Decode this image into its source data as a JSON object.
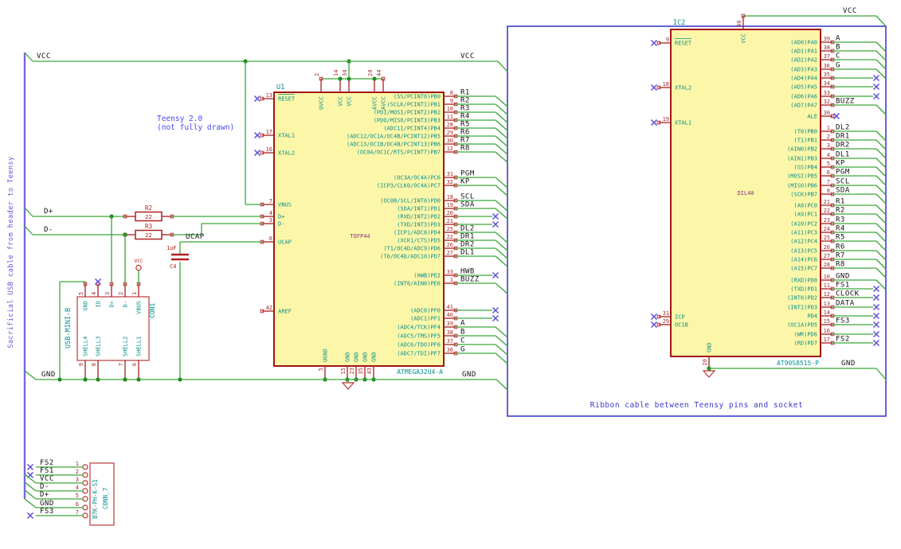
{
  "notes": {
    "left_rotated": "Sacrificial USB cable from header to Teensy",
    "teensy1": "Teensy 2.0",
    "teensy2": "(not fully drawn)",
    "ribbon": "Ribbon cable between Teensy pins and socket"
  },
  "colors": {
    "wire": "#3aa63a",
    "bus": "#7668d8",
    "frame": "#3c3ccd",
    "ic_border": "#a31515",
    "ic_fill": "#fcf7a8",
    "conn_border": "#c86060",
    "pin_name": "#0a8f8f",
    "pin_number": "#a62a2a",
    "net_label": "#101010",
    "junction": "#228b22",
    "nc": "#5b4fdd",
    "device_red": "#b02020",
    "package": "#8d2f8d"
  },
  "nets": {
    "vcc": "VCC",
    "gnd": "GND",
    "dplus": "D+",
    "dminus": "D-",
    "ucap": "UCAP"
  },
  "u1": {
    "ref": "U1",
    "value": "ATMEGA32U4-A",
    "package": "TQFP44",
    "top_pins": [
      [
        "2",
        "UVCC"
      ],
      [
        "14",
        "VCC"
      ],
      [
        "34",
        "VCC"
      ],
      [
        "24",
        "AVCC"
      ],
      [
        "44",
        "AVCC"
      ]
    ],
    "bottom_pins": [
      [
        "5",
        "UGND"
      ],
      [
        "15",
        "GND"
      ],
      [
        "23",
        "GND"
      ],
      [
        "35",
        "GND"
      ],
      [
        "43",
        "GND"
      ]
    ],
    "left_pins": [
      [
        "13",
        "RESET",
        "nc"
      ],
      [
        "17",
        "XTAL1",
        "nc"
      ],
      [
        "16",
        "XTAL2",
        "nc"
      ],
      [
        "7",
        "VBUS",
        "wire"
      ],
      [
        "4",
        "D+",
        "wire"
      ],
      [
        "3",
        "D-",
        "wire"
      ],
      [
        "6",
        "UCAP",
        "wire"
      ],
      [
        "42",
        "AREF",
        "stub"
      ]
    ],
    "right_pins": [
      [
        "8",
        "(SS/PCINT0)PB0",
        "R1",
        "bus"
      ],
      [
        "9",
        "(SCLK/PCINT1)PB1",
        "R2",
        "bus"
      ],
      [
        "10",
        "(PDI/MOSI/PCINT2)PB2",
        "R3",
        "bus"
      ],
      [
        "11",
        "(PDO/MISO/PCINT3)PB3",
        "R4",
        "bus"
      ],
      [
        "28",
        "(ADC11/PCINT4)PB4",
        "R5",
        "bus"
      ],
      [
        "29",
        "(ADC12/OC1A/OC4B/PCINT12)PB5",
        "R6",
        "bus"
      ],
      [
        "30",
        "(ADC13/OC1B/OC4B/PCINT13)PB6",
        "R7",
        "bus"
      ],
      [
        "12",
        "(OC0A/OC1C/RTS/PCINT7)PB7",
        "R8",
        "bus"
      ],
      [
        "31",
        "(OC3A/OC4A)PC6",
        "PGM",
        "bus"
      ],
      [
        "32",
        "(ICP3/CLK0/OC4A)PC7",
        "KP",
        "bus"
      ],
      [
        "18",
        "(OC0B/SCL/INT0)PD0",
        "SCL",
        "bus"
      ],
      [
        "19",
        "(SDA/INT1)PD1",
        "SDA",
        "bus"
      ],
      [
        "20",
        "(RXD/INT2)PD2",
        "",
        "nc"
      ],
      [
        "21",
        "(TXD/INT3)PD3",
        "",
        "nc"
      ],
      [
        "25",
        "(ICP1/ADC8)PD4",
        "DL2",
        "bus"
      ],
      [
        "22",
        "(XCK1/CTS)PD5",
        "DR1",
        "bus"
      ],
      [
        "26",
        "(T1/OC4D/ADC9)PD6",
        "DR2",
        "bus"
      ],
      [
        "27",
        "(T0/OC4D/ADC10)PD7",
        "DL1",
        "bus"
      ],
      [
        "33",
        "(HWB)PE2",
        "HWB",
        "nc"
      ],
      [
        "1",
        "(INT6/AIN0)PE6",
        "BUZZ",
        "bus"
      ],
      [
        "41",
        "(ADC0)PF0",
        "",
        "nc"
      ],
      [
        "40",
        "(ADC1)PF1",
        "",
        "nc"
      ],
      [
        "39",
        "(ADC4/TCK)PF4",
        "A",
        "bus"
      ],
      [
        "38",
        "(ADC5/TMS)PF5",
        "B",
        "bus"
      ],
      [
        "37",
        "(ADC6/TDO)PF6",
        "C",
        "bus"
      ],
      [
        "36",
        "(ADC7/TDI)PF7",
        "G",
        "bus"
      ]
    ]
  },
  "ic2": {
    "ref": "IC2",
    "value": "AT90S8515-P",
    "package": "DIL40",
    "top_pins": [
      [
        "40",
        "VCC"
      ]
    ],
    "bottom_pins": [
      [
        "20",
        "GND"
      ]
    ],
    "left_pins": [
      [
        "9",
        "RESET",
        "nc"
      ],
      [
        "18",
        "XTAL2",
        "nc"
      ],
      [
        "19",
        "XTAL1",
        "nc"
      ],
      [
        "31",
        "ICP",
        "nc"
      ],
      [
        "29",
        "OC1B",
        "nc"
      ]
    ],
    "right_pins": [
      [
        "39",
        "(AD0)PA0",
        "A",
        "bus"
      ],
      [
        "38",
        "(AD1)PA1",
        "B",
        "bus"
      ],
      [
        "37",
        "(AD2)PA2",
        "C",
        "bus"
      ],
      [
        "36",
        "(AD3)PA3",
        "G",
        "bus"
      ],
      [
        "35",
        "(AD4)PA4",
        "",
        "nc"
      ],
      [
        "34",
        "(AD5)PA5",
        "",
        "nc"
      ],
      [
        "33",
        "(AD6)PA6",
        "",
        "nc"
      ],
      [
        "32",
        "(AD7)PA7",
        "BUZZ",
        "bus"
      ],
      [
        "30",
        "ALE",
        "",
        "ncshort"
      ],
      [
        "1",
        "(T0)PB0",
        "DL2",
        "bus"
      ],
      [
        "2",
        "(T1)PB1",
        "DR1",
        "bus"
      ],
      [
        "3",
        "(AIN0)PB2",
        "DR2",
        "bus"
      ],
      [
        "4",
        "(AIN1)PB3",
        "DL1",
        "bus"
      ],
      [
        "5",
        "(SS)PB4",
        "KP",
        "bus"
      ],
      [
        "6",
        "(MOSI)PB5",
        "PGM",
        "bus"
      ],
      [
        "7",
        "(MISO)PB6",
        "SCL",
        "bus"
      ],
      [
        "8",
        "(SCK)PB7",
        "SDA",
        "bus"
      ],
      [
        "21",
        "(A8)PC0",
        "R1",
        "bus"
      ],
      [
        "22",
        "(A9)PC1",
        "R2",
        "bus"
      ],
      [
        "23",
        "(A10)PC2",
        "R3",
        "bus"
      ],
      [
        "24",
        "(A11)PC3",
        "R4",
        "bus"
      ],
      [
        "25",
        "(A12)PC4",
        "R5",
        "bus"
      ],
      [
        "26",
        "(A13)PC5",
        "R6",
        "bus"
      ],
      [
        "27",
        "(A14)PC6",
        "R7",
        "bus"
      ],
      [
        "28",
        "(A15)PC7",
        "R8",
        "bus"
      ],
      [
        "10",
        "(RXD)PD0",
        "GND",
        "bus"
      ],
      [
        "11",
        "(TXD)PD1",
        "FS1",
        "nc"
      ],
      [
        "12",
        "(INT0)PD2",
        "CLOCK",
        "nc"
      ],
      [
        "13",
        "(INT1)PD3",
        "DATA",
        "nc"
      ],
      [
        "14",
        "PD4",
        "",
        "nc"
      ],
      [
        "15",
        "(OC1A)PD5",
        "FS3",
        "nc"
      ],
      [
        "16",
        "(WR)PD6",
        "",
        "nc"
      ],
      [
        "17",
        "(RD)PD7",
        "FS2",
        "nc"
      ]
    ]
  },
  "con1": {
    "ref": "CON1",
    "value": "USB-MINI-B",
    "top_pins": [
      [
        "5",
        "GND"
      ],
      [
        "4",
        "ID"
      ],
      [
        "3",
        "D+"
      ],
      [
        "2",
        "D-"
      ],
      [
        "1",
        "VBUS"
      ]
    ],
    "bottom_pins": [
      [
        "9",
        "SHELL4"
      ],
      [
        "8",
        "SHELL3"
      ],
      [
        "7",
        "SHELL2"
      ],
      [
        "6",
        "SHELL1"
      ]
    ]
  },
  "conn7": {
    "ref": "CONN_7",
    "value": "B7K-PH-K-S1",
    "pins": [
      [
        "1",
        "FS2",
        "nc"
      ],
      [
        "2",
        "FS1",
        "nc"
      ],
      [
        "3",
        "VCC",
        "bus"
      ],
      [
        "4",
        "D-",
        "bus"
      ],
      [
        "5",
        "D+",
        "bus"
      ],
      [
        "6",
        "GND",
        "bus"
      ],
      [
        "7",
        "FS3",
        "nc"
      ]
    ]
  },
  "r2": {
    "ref": "R2",
    "value": "22"
  },
  "r3": {
    "ref": "R3",
    "value": "22"
  },
  "c4": {
    "ref": "C4",
    "value": "1uF"
  },
  "pwr": {
    "vcc": "VCC"
  }
}
